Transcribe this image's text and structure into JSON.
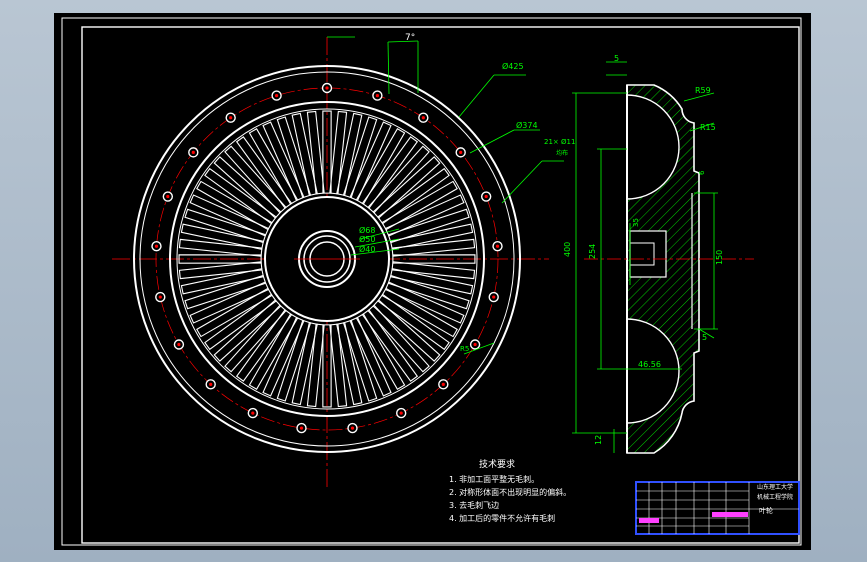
{
  "colors": {
    "background": "#000000",
    "line": "#ffffff",
    "dimension": "#00ff00",
    "centerline": "#ff0000",
    "hatch": "#00ff00",
    "title_block": "#3050ff",
    "magenta": "#ff40ff"
  },
  "front_view": {
    "dims": {
      "d425": "Ø425",
      "d374": "Ø374",
      "holes": "21× Ø11",
      "holes_sub": "均布",
      "d68": "Ø68",
      "d50": "Ø50",
      "d40": "Ø40",
      "angle": "7°",
      "fillet": "R5"
    }
  },
  "side_view": {
    "dims": {
      "top5": "5",
      "r59": "R59",
      "r15": "R15",
      "d400": "400",
      "d254": "254",
      "d150": "150",
      "d35": "35",
      "d4656": "46.56",
      "d12": "12",
      "d5b": "5",
      "d6": "6"
    }
  },
  "notes": {
    "title": "技术要求",
    "items": [
      "1. 非加工面平整无毛刺。",
      "2. 对称形体面不出现明显的偏斜。",
      "3. 去毛刺飞边",
      "4. 加工后的零件不允许有毛刺"
    ]
  },
  "title_block": {
    "school": "山东理工大学",
    "dept": "机械工程学院",
    "part": "叶轮"
  }
}
